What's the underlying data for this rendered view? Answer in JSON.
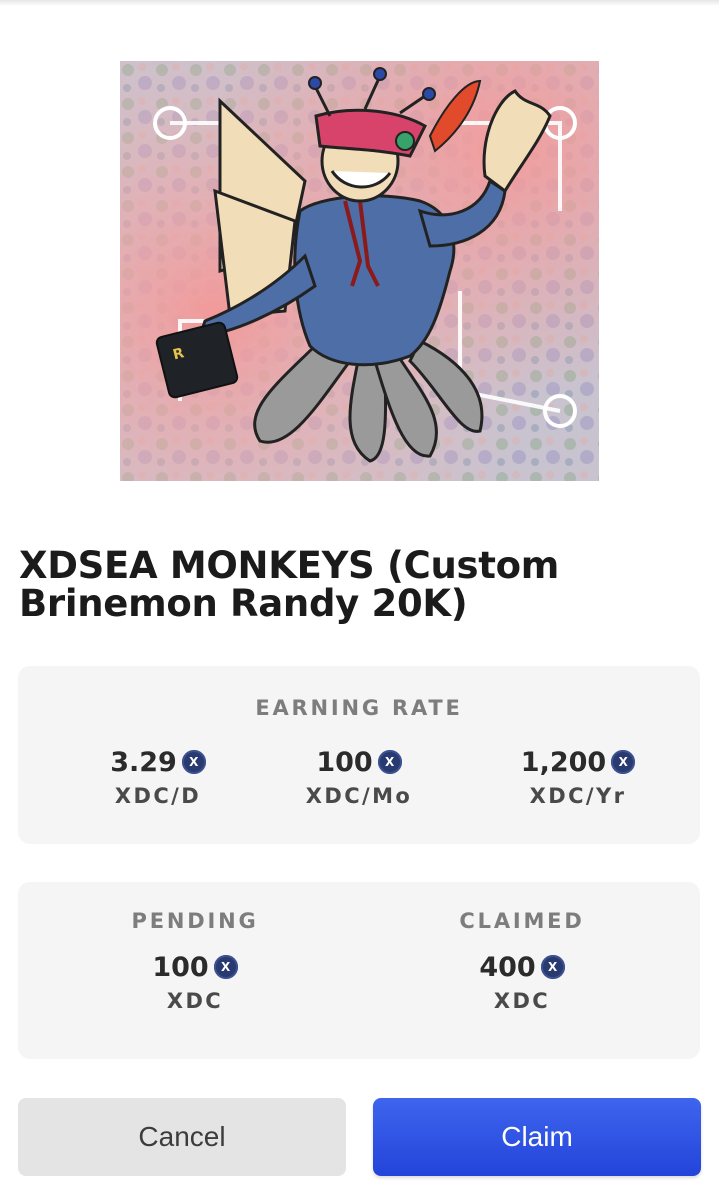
{
  "nft": {
    "title": "XDSEA MONKEYS (Custom Brinemon Randy 20K)",
    "image_description_icon": "nft-artwork",
    "card_letter": "R"
  },
  "earning_rate": {
    "label": "EARNING RATE",
    "daily": {
      "value": "3.29",
      "unit": "XDC/D"
    },
    "monthly": {
      "value": "100",
      "unit": "XDC/Mo"
    },
    "yearly": {
      "value": "1,200",
      "unit": "XDC/Yr"
    }
  },
  "status": {
    "pending": {
      "label": "PENDING",
      "value": "100",
      "unit": "XDC"
    },
    "claimed": {
      "label": "CLAIMED",
      "value": "400",
      "unit": "XDC"
    }
  },
  "xdc_icon_glyph": "X",
  "actions": {
    "cancel_label": "Cancel",
    "claim_label": "Claim"
  },
  "colors": {
    "claim_button": "#2f55e4",
    "cancel_button": "#e4e4e4",
    "panel_bg": "#f5f5f5",
    "xdc_icon": "#283a70"
  }
}
